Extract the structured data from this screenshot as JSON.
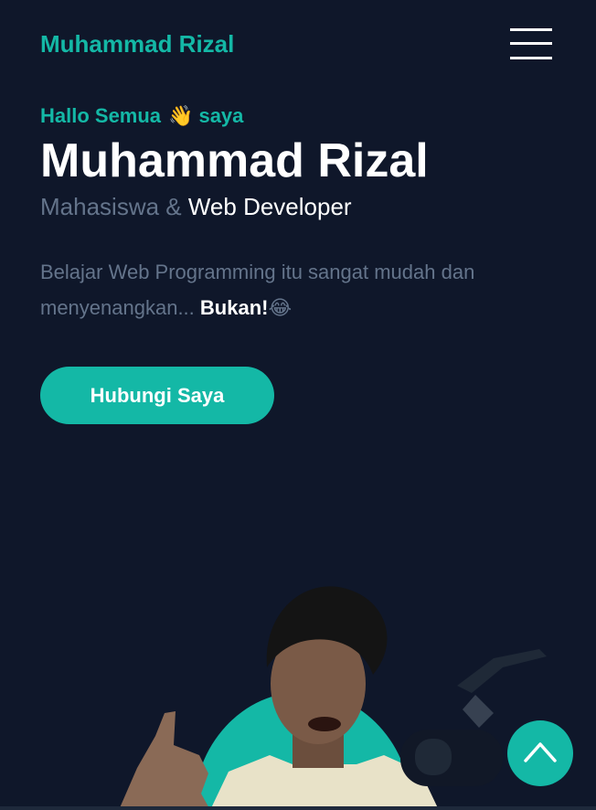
{
  "nav": {
    "logo": "Muhammad Rizal",
    "menu_icon": "hamburger-menu-icon"
  },
  "hero": {
    "greeting_prefix": "Hallo Semua",
    "greeting_emoji": "👋",
    "greeting_suffix": "saya",
    "name": "Muhammad Rizal",
    "role_secondary": "Mahasiswa &",
    "role_primary": "Web Developer",
    "description": "Belajar Web Programming itu sangat mudah dan menyenangkan...",
    "description_emphasis": "Bukan!",
    "description_emoji": "😂",
    "cta_label": "Hubungi Saya"
  },
  "scroll_top": {
    "icon": "chevron-up-icon"
  },
  "colors": {
    "background": "#0f172a",
    "accent": "#14b8a6",
    "muted_text": "#64748b",
    "primary_text": "#ffffff"
  }
}
